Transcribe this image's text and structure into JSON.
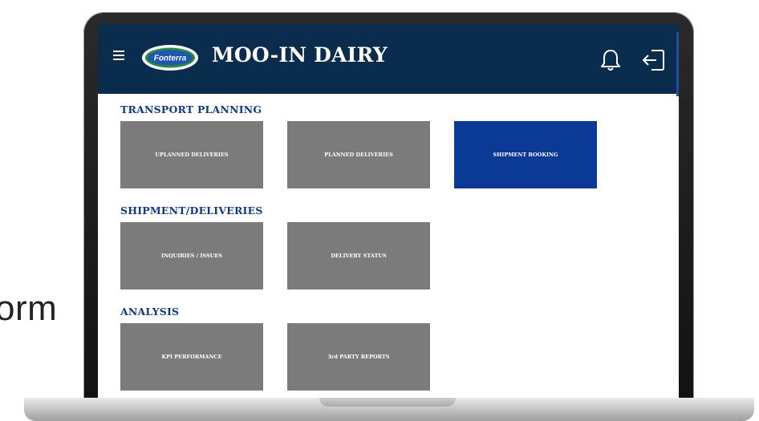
{
  "background_text": "orm",
  "header": {
    "app_title": "MOO-IN DAIRY",
    "logo_text": "Fonterra",
    "menu_icon": "hamburger-icon",
    "notification_icon": "bell-icon",
    "logout_icon": "logout-icon"
  },
  "sections": [
    {
      "title": "TRANSPORT PLANNING",
      "tiles": [
        "UPLANNED DELIVERIES",
        "PLANNED DELIVERIES",
        "SHIPMENT BOOKING"
      ]
    },
    {
      "title": "SHIPMENT/DELIVERIES",
      "tiles": [
        "INQUIRIES / ISSUES",
        "DELIVERY STATUS"
      ]
    },
    {
      "title": "ANALYSIS",
      "tiles": [
        "KPI PERFORMANCE",
        "3rd PARTY REPORTS"
      ]
    }
  ],
  "colors": {
    "header_bg": "#0b2d4d",
    "tile_bg": "#7b7b7b",
    "tile_active_bg": "#0b3a96",
    "section_title": "#0d3b8c"
  }
}
